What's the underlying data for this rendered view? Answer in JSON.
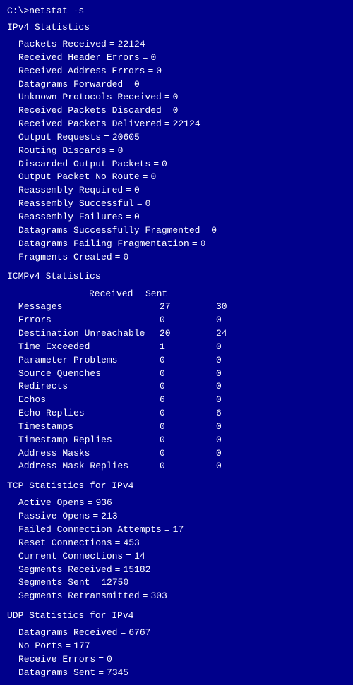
{
  "prompt": "C:\\>netstat -s",
  "ipv4": {
    "title": "IPv4 Statistics",
    "stats": [
      {
        "label": "Packets Received",
        "value": "22124"
      },
      {
        "label": "Received Header Errors",
        "value": "0"
      },
      {
        "label": "Received Address Errors",
        "value": "0"
      },
      {
        "label": "Datagrams Forwarded",
        "value": "0"
      },
      {
        "label": "Unknown Protocols Received",
        "value": "0"
      },
      {
        "label": "Received Packets Discarded",
        "value": "0"
      },
      {
        "label": "Received Packets Delivered",
        "value": "22124"
      },
      {
        "label": "Output Requests",
        "value": "20605"
      },
      {
        "label": "Routing Discards",
        "value": "0"
      },
      {
        "label": "Discarded Output Packets",
        "value": "0"
      },
      {
        "label": "Output Packet No Route",
        "value": "0"
      },
      {
        "label": "Reassembly Required",
        "value": "0"
      },
      {
        "label": "Reassembly Successful",
        "value": "0"
      },
      {
        "label": "Reassembly Failures",
        "value": "0"
      },
      {
        "label": "Datagrams Successfully Fragmented",
        "value": "0"
      },
      {
        "label": "Datagrams Failing Fragmentation",
        "value": "0"
      },
      {
        "label": "Fragments Created",
        "value": "0"
      }
    ]
  },
  "icmpv4": {
    "title": "ICMPv4 Statistics",
    "header": {
      "received": "Received",
      "sent": "Sent"
    },
    "rows": [
      {
        "label": "Messages",
        "received": "27",
        "sent": "30"
      },
      {
        "label": "Errors",
        "received": "0",
        "sent": "0"
      },
      {
        "label": "Destination Unreachable",
        "received": "20",
        "sent": "24"
      },
      {
        "label": "Time Exceeded",
        "received": "1",
        "sent": "0"
      },
      {
        "label": "Parameter Problems",
        "received": "0",
        "sent": "0"
      },
      {
        "label": "Source Quenches",
        "received": "0",
        "sent": "0"
      },
      {
        "label": "Redirects",
        "received": "0",
        "sent": "0"
      },
      {
        "label": "Echos",
        "received": "6",
        "sent": "0"
      },
      {
        "label": "Echo Replies",
        "received": "0",
        "sent": "6"
      },
      {
        "label": "Timestamps",
        "received": "0",
        "sent": "0"
      },
      {
        "label": "Timestamp Replies",
        "received": "0",
        "sent": "0"
      },
      {
        "label": "Address Masks",
        "received": "0",
        "sent": "0"
      },
      {
        "label": "Address Mask Replies",
        "received": "0",
        "sent": "0"
      }
    ]
  },
  "tcp": {
    "title": "TCP Statistics for IPv4",
    "stats": [
      {
        "label": "Active Opens",
        "value": "936"
      },
      {
        "label": "Passive Opens",
        "value": "213"
      },
      {
        "label": "Failed Connection Attempts",
        "value": "17"
      },
      {
        "label": "Reset Connections",
        "value": "453"
      },
      {
        "label": "Current Connections",
        "value": "14"
      },
      {
        "label": "Segments Received",
        "value": "15182"
      },
      {
        "label": "Segments Sent",
        "value": "12750"
      },
      {
        "label": "Segments Retransmitted",
        "value": "303"
      }
    ]
  },
  "udp": {
    "title": "UDP Statistics for IPv4",
    "stats": [
      {
        "label": "Datagrams Received",
        "value": "6767"
      },
      {
        "label": "No Ports",
        "value": "177"
      },
      {
        "label": "Receive Errors",
        "value": "0"
      },
      {
        "label": "Datagrams Sent",
        "value": "7345"
      }
    ]
  }
}
